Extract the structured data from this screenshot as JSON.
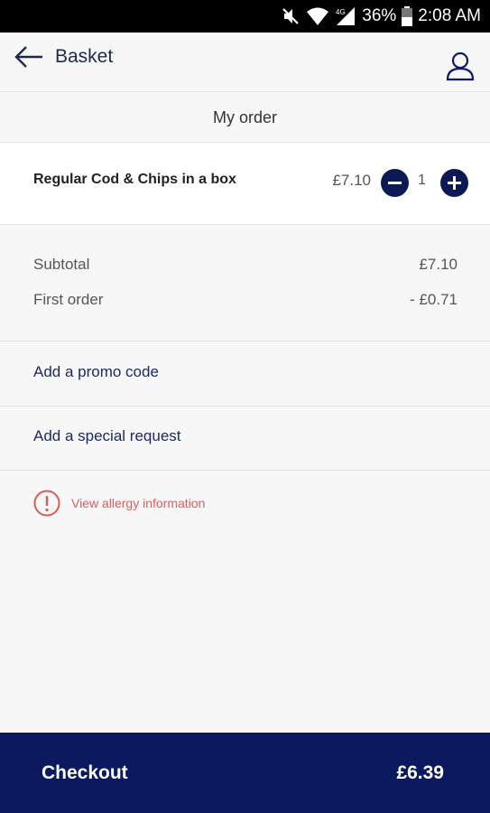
{
  "status_bar": {
    "battery": "36%",
    "time": "2:08 AM",
    "network_label": "4G",
    "icons": [
      "mute-icon",
      "wifi-icon",
      "signal-icon",
      "battery-icon"
    ]
  },
  "header": {
    "title": "Basket",
    "back_icon": "back-arrow-icon",
    "account_icon": "user-icon"
  },
  "order": {
    "section_title": "My order",
    "items": [
      {
        "name": "Regular Cod & Chips in a box",
        "price": "£7.10",
        "quantity": "1"
      }
    ]
  },
  "summary": {
    "subtotal_label": "Subtotal",
    "subtotal_value": "£7.10",
    "discount_label": "First order",
    "discount_value": "- £0.71"
  },
  "links": {
    "promo": "Add a promo code",
    "special_request": "Add a special request"
  },
  "allergy": {
    "text": "View allergy information",
    "icon": "alert-circle-icon"
  },
  "checkout": {
    "label": "Checkout",
    "total": "£6.39"
  },
  "colors": {
    "brand_navy": "#0b1a5e",
    "link_blue": "#1c2a63",
    "allergy_red": "#e05a5a",
    "background": "#f7f7f7"
  }
}
